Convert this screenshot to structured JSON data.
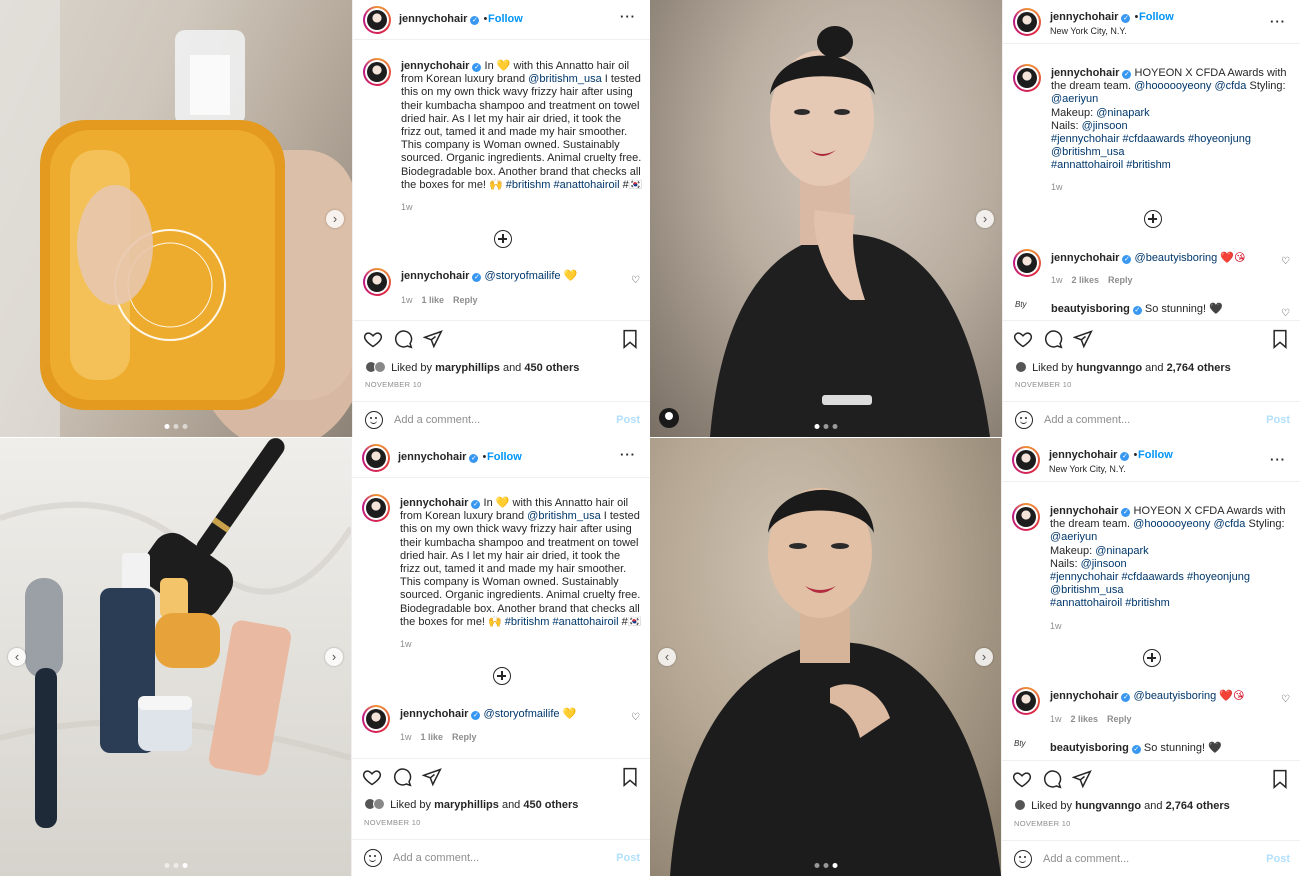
{
  "post_product": {
    "username": "jennychohair",
    "follow": "Follow",
    "caption_prefix": "In ",
    "caption_emoji1": "💛",
    "caption_text": " with this Annatto hair oil from Korean luxury brand ",
    "caption_mention": "@britishm_usa",
    "caption_body": " I tested this on my own thick wavy frizzy hair after using their kumbacha shampoo and treatment on towel dried hair. As I let my hair air dried, it took the frizz out, tamed it and made my hair smoother. This company is Woman owned. Sustainably sourced. Organic ingredients. Animal cruelty free. Biodegradable box. Another brand that checks all the boxes for me! 🙌 ",
    "caption_tags": "#britishm #anattohairoil",
    "caption_end": " #🇰🇷",
    "caption_time": "1w",
    "comment_user": "jennychohair",
    "comment_mention": "@storyofmailife",
    "comment_emoji": "💛",
    "comment_time": "1w",
    "comment_likes": "1 like",
    "comment_reply": "Reply",
    "liked_by_prefix": "Liked by ",
    "liked_by_user": "maryphillips",
    "liked_by_and": " and ",
    "liked_by_count": "450 others",
    "date": "NOVEMBER 10",
    "add_comment": "Add a comment...",
    "post_button": "Post"
  },
  "post_awards": {
    "username": "jennychohair",
    "follow": "Follow",
    "location": "New York City, N.Y.",
    "caption_head": " HOYEON X CFDA Awards with the dream team. ",
    "caption_mention1": "@hoooooyeony",
    "caption_mention2": "@cfda",
    "caption_styling": " Styling:",
    "caption_aeri": "@aeriyun",
    "caption_makeup_label": "Makeup: ",
    "caption_nina": "@ninapark",
    "caption_nails_label": "Nails: ",
    "caption_jin": "@jinsoon",
    "caption_tags1": "#jennychohair #cfdaawards #hoyeonjung",
    "caption_britishm": "@britishm_usa",
    "caption_tags2": "#annattohairoil #britishm",
    "caption_time": "1w",
    "comment1_user": "jennychohair",
    "comment1_mention": "@beautyisboring",
    "comment1_emoji": "❤️😘",
    "comment1_time": "1w",
    "comment1_likes": "2 likes",
    "comment1_reply": "Reply",
    "comment2_user": "beautyisboring",
    "comment2_text": " So stunning! 🖤",
    "liked_by_prefix": "Liked by ",
    "liked_by_user": "hungvanngo",
    "liked_by_and": " and ",
    "liked_by_count": "2,764 others",
    "date": "NOVEMBER 10",
    "add_comment": "Add a comment...",
    "post_button": "Post"
  },
  "icons": [
    "heart-icon",
    "comment-icon",
    "share-icon",
    "bookmark-icon",
    "more-icon",
    "add-icon",
    "emoji-icon",
    "verified-icon"
  ],
  "colors": {
    "link": "#00376b",
    "follow": "#0095f6",
    "muted": "#8e8e8e",
    "post_disabled": "#b2dffc"
  }
}
